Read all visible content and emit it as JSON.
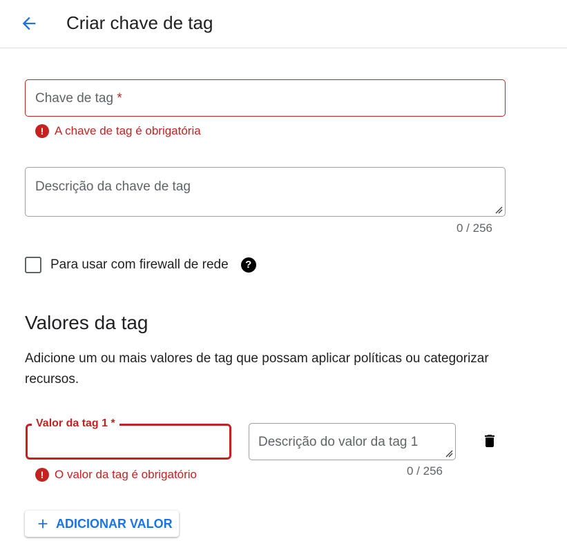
{
  "header": {
    "title": "Criar chave de tag",
    "back_icon": "arrow-back-icon"
  },
  "tag_key": {
    "placeholder": "Chave de tag",
    "required_mark": "*",
    "error": "A chave de tag é obrigatória"
  },
  "tag_key_description": {
    "placeholder": "Descrição da chave de tag",
    "counter": "0 / 256"
  },
  "firewall": {
    "label": "Para usar com firewall de rede",
    "checked": false,
    "help_icon": "help-icon"
  },
  "values_section": {
    "title": "Valores da tag",
    "description": "Adicione um ou mais valores de tag que possam aplicar políticas ou categorizar recursos."
  },
  "tag_values": [
    {
      "label": "Valor da tag 1 *",
      "value": "",
      "error": "O valor da tag é obrigatório",
      "description_placeholder": "Descrição do valor da tag 1",
      "counter": "0 / 256"
    }
  ],
  "add_button": {
    "label": "ADICIONAR VALOR",
    "icon": "plus-icon"
  },
  "colors": {
    "error": "#c5221f",
    "accent": "#1a73e8",
    "text": "#202124",
    "secondary_text": "#5f6368"
  }
}
